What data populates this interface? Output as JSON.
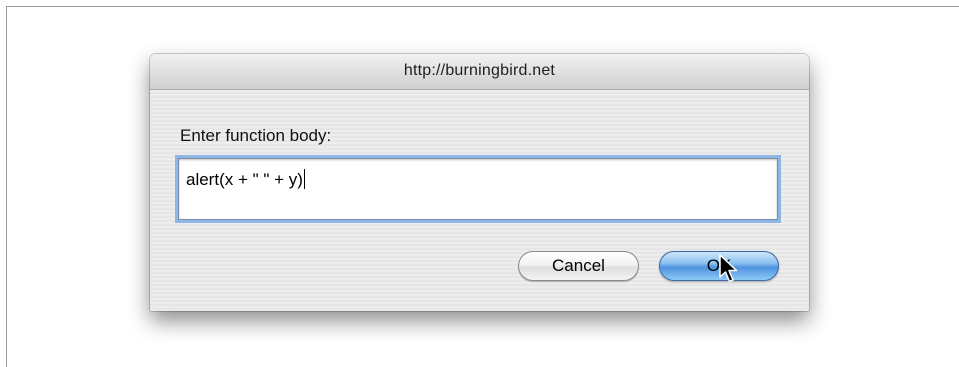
{
  "dialog": {
    "title": "http://burningbird.net",
    "prompt": "Enter function body:",
    "input_value": "alert(x + \" \" + y)",
    "cancel_label": "Cancel",
    "ok_label": "OK"
  },
  "icons": {
    "cursor": "mouse-pointer-icon"
  },
  "colors": {
    "focus_ring": "#8fb6e4",
    "default_button": "#4f93df"
  }
}
